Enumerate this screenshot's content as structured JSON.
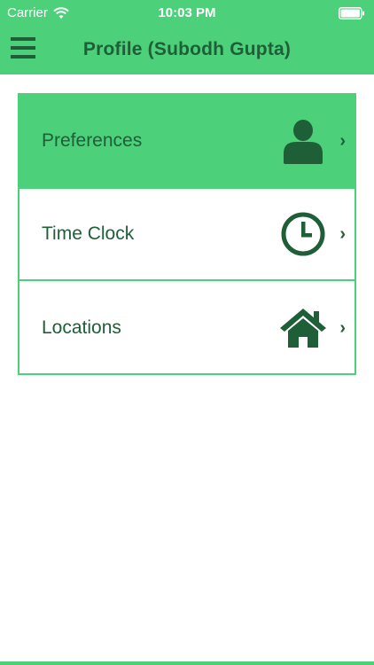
{
  "status_bar": {
    "carrier": "Carrier",
    "time": "10:03 PM"
  },
  "nav": {
    "title": "Profile (Subodh Gupta)",
    "menu_icon": "hamburger-menu-icon"
  },
  "menu": {
    "items": [
      {
        "label": "Preferences",
        "icon": "person-icon",
        "chevron": "›",
        "active": true
      },
      {
        "label": "Time Clock",
        "icon": "clock-icon",
        "chevron": "›",
        "active": false
      },
      {
        "label": "Locations",
        "icon": "house-icon",
        "chevron": "›",
        "active": false
      }
    ]
  },
  "colors": {
    "accent": "#4cd07a",
    "text_dark_green": "#1e5f38",
    "background": "#ffffff"
  }
}
